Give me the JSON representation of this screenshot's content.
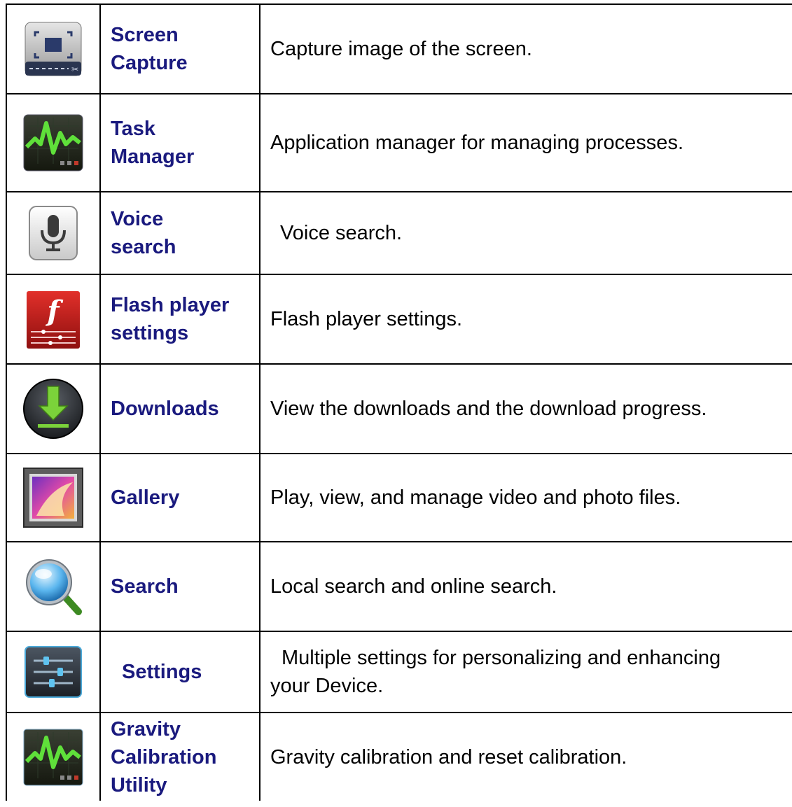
{
  "rows": [
    {
      "icon": "screen-capture-icon",
      "name": "Screen Capture",
      "name_lines": [
        "Screen",
        "Capture"
      ],
      "description": "Capture image of the screen.",
      "desc_lines": [
        "Capture image of the screen."
      ]
    },
    {
      "icon": "task-manager-icon",
      "name": "Task Manager",
      "name_lines": [
        "Task",
        "Manager"
      ],
      "description": "Application manager for managing processes.",
      "desc_lines": [
        "Application manager for managing processes."
      ]
    },
    {
      "icon": "voice-search-icon",
      "name": "Voice search",
      "name_lines": [
        "Voice",
        "search"
      ],
      "description": "Voice search.",
      "desc_lines": [
        "Voice search."
      ]
    },
    {
      "icon": "flash-player-icon",
      "name": "Flash player settings",
      "name_lines": [
        "Flash player",
        "settings"
      ],
      "description": "Flash player settings.",
      "desc_lines": [
        "Flash player settings."
      ]
    },
    {
      "icon": "downloads-icon",
      "name": "Downloads",
      "name_lines": [
        "Downloads"
      ],
      "description": "View the downloads and the download progress.",
      "desc_lines": [
        "View the downloads and the download progress."
      ]
    },
    {
      "icon": "gallery-icon",
      "name": "Gallery",
      "name_lines": [
        "Gallery"
      ],
      "description": "Play, view, and manage video and photo files.",
      "desc_lines": [
        "Play, view, and manage video and photo files."
      ]
    },
    {
      "icon": "search-icon",
      "name": "Search",
      "name_lines": [
        "Search"
      ],
      "description": "Local search and online search.",
      "desc_lines": [
        "Local search and online search."
      ]
    },
    {
      "icon": "settings-icon",
      "name": "Settings",
      "name_lines": [
        "Settings"
      ],
      "description": "Multiple settings for personalizing and enhancing your Device.",
      "desc_lines": [
        "Multiple settings for personalizing and enhancing",
        "your Device."
      ]
    },
    {
      "icon": "gravity-calibration-icon",
      "name": "Gravity Calibration Utility",
      "name_lines": [
        "Gravity",
        "Calibration",
        "Utility"
      ],
      "description": "Gravity calibration and reset calibration.",
      "desc_lines": [
        "Gravity calibration and reset calibration."
      ]
    }
  ],
  "colors": {
    "name_text": "#1a1a7e",
    "border": "#000000"
  }
}
